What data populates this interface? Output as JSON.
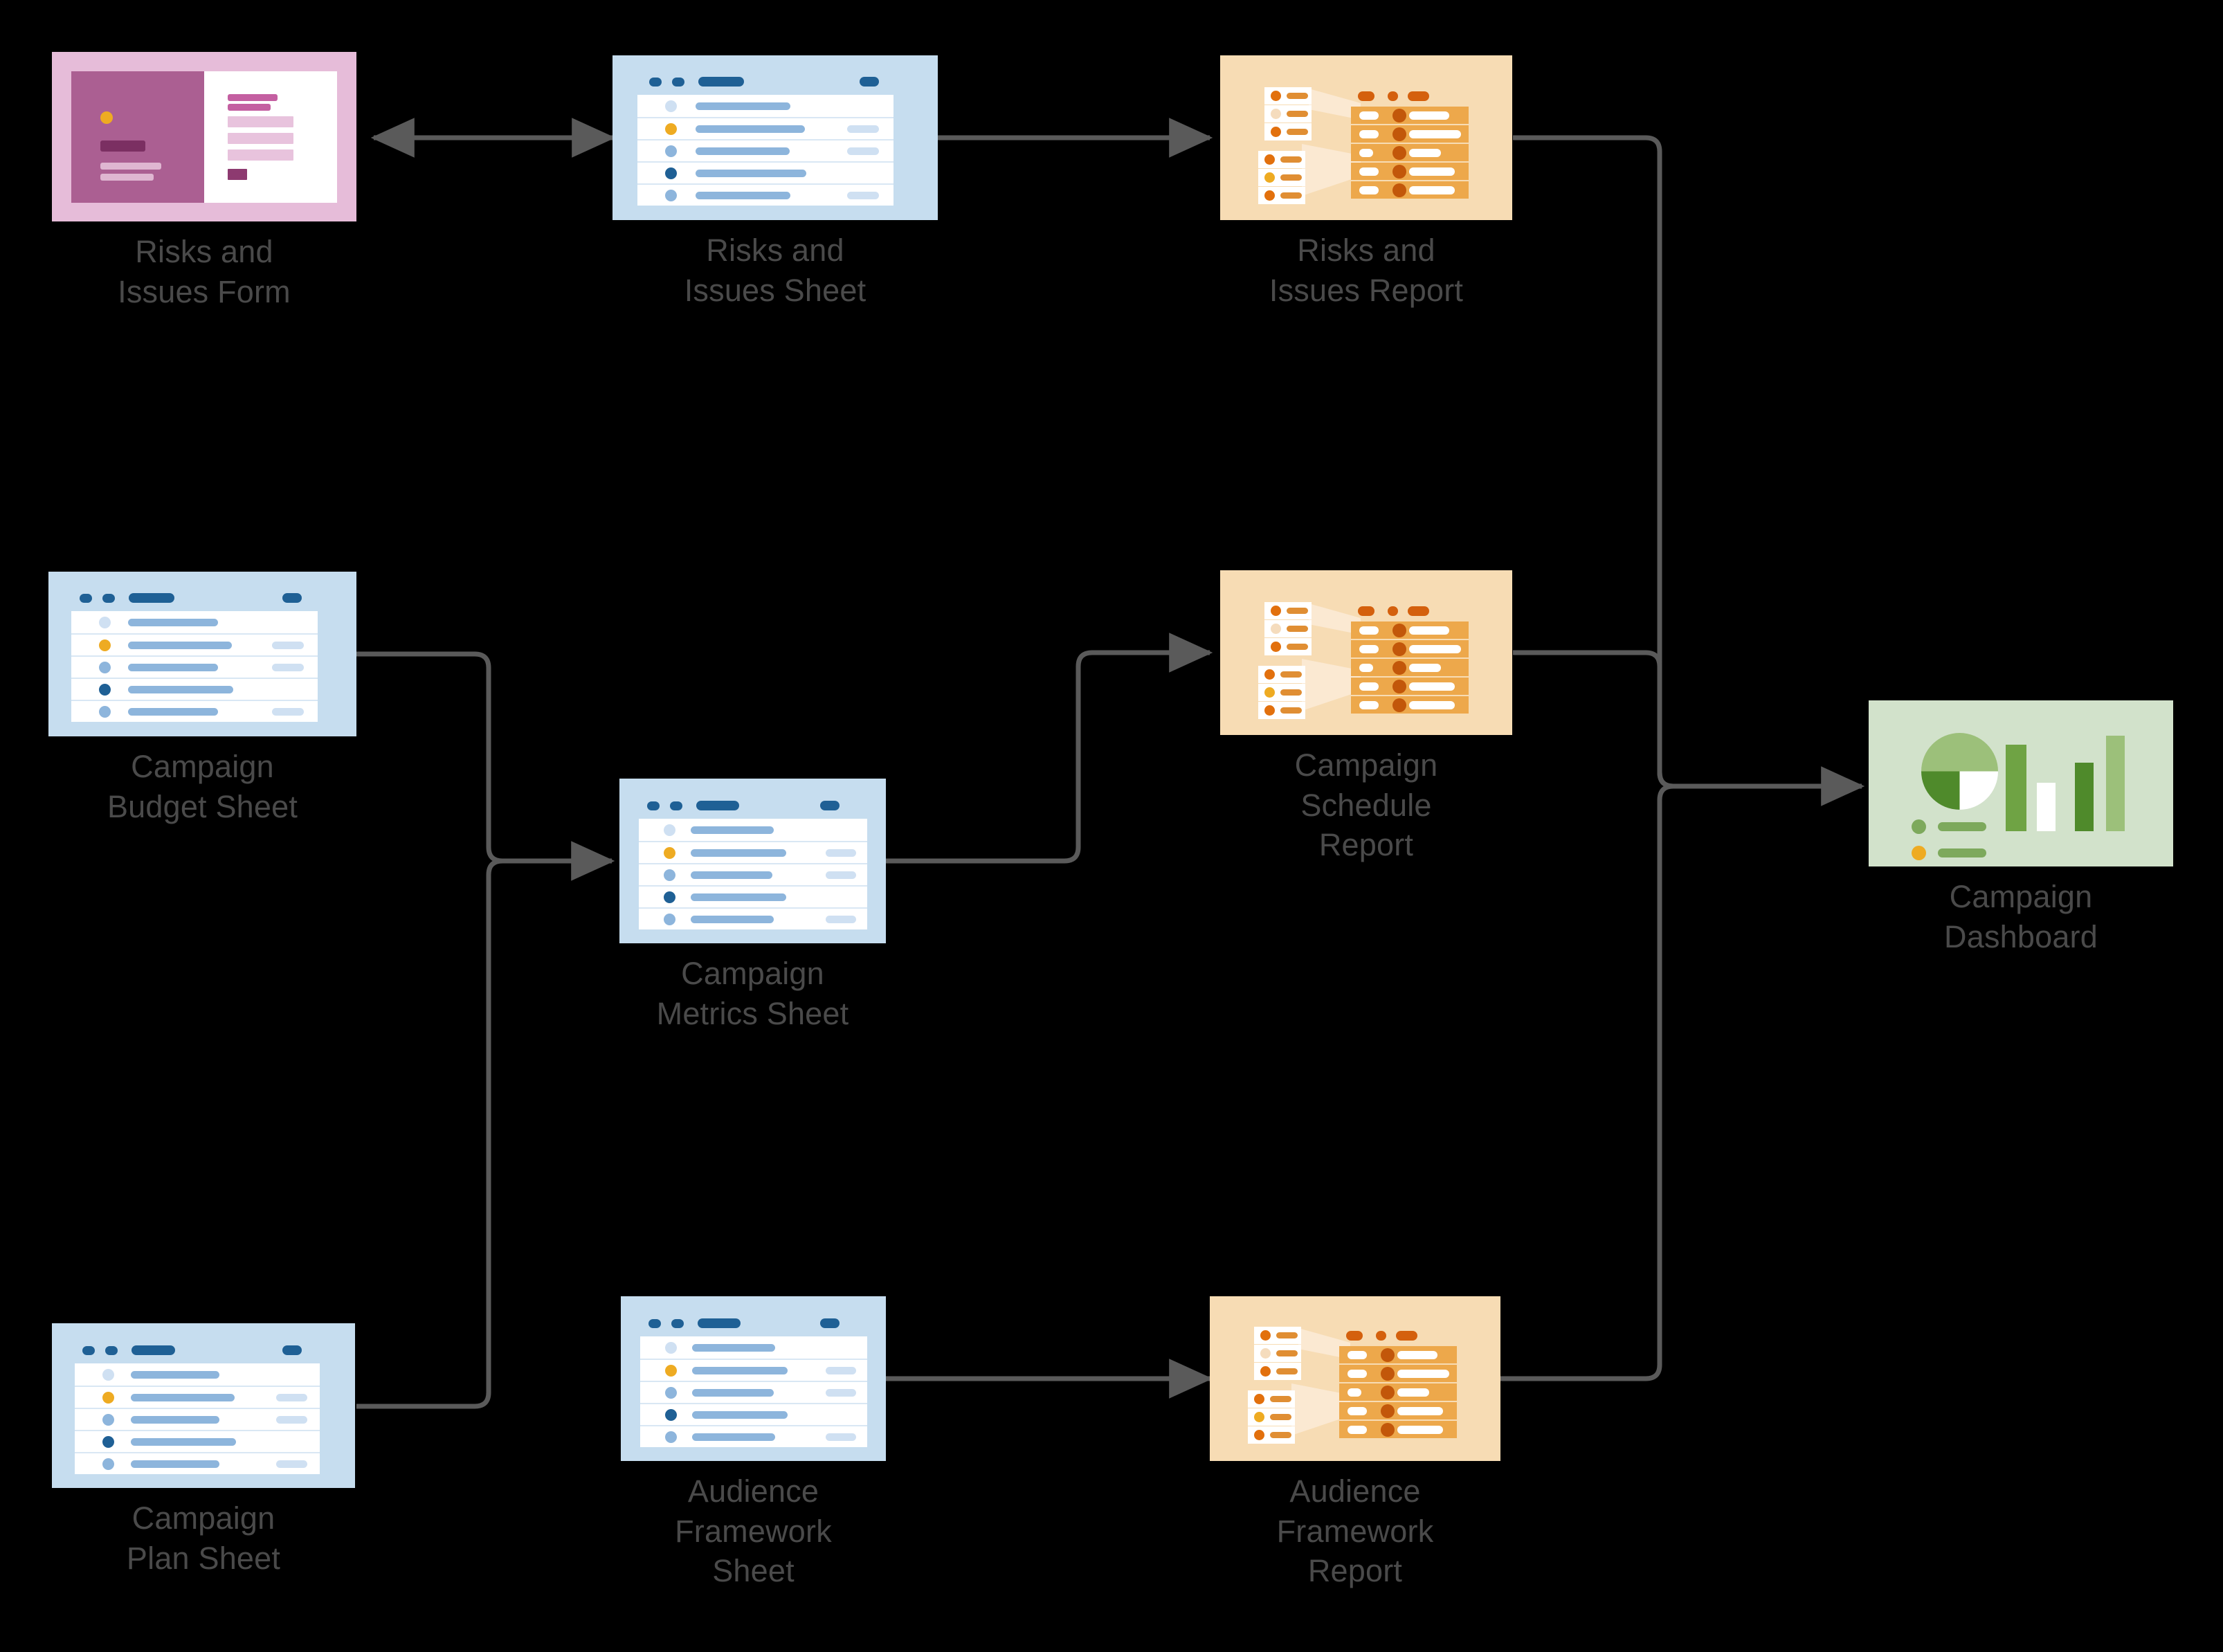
{
  "diagram": {
    "title": "Campaign data flow diagram",
    "background": "#000000",
    "edge_color": "#5a5a5a",
    "label_color": "#4a4a4a",
    "palette": {
      "sheet_bg": "#c6ddef",
      "sheet_accent": "#1f6095",
      "sheet_line": "#8db5dc",
      "sheet_line_light": "#cfe0f2",
      "report_bg": "#f7dcb4",
      "report_row": "#eda84b",
      "report_accent": "#d4600d",
      "report_dot": "#c2570a",
      "form_bg": "#e6bcd9",
      "form_panel": "#ab5f92",
      "form_dark": "#7b2f62",
      "dashboard_bg": "#d2e2cb",
      "dashboard_green_dark": "#4f8a2b",
      "dashboard_green_mid": "#6fa344",
      "dashboard_green_light": "#9cc07a",
      "amber": "#eeab22"
    }
  },
  "nodes": [
    {
      "id": "risks-issues-form",
      "label": "Risks and\nIssues Form",
      "type": "form"
    },
    {
      "id": "risks-issues-sheet",
      "label": "Risks and\nIssues Sheet",
      "type": "sheet"
    },
    {
      "id": "risks-issues-report",
      "label": "Risks and\nIssues Report",
      "type": "report"
    },
    {
      "id": "campaign-budget-sheet",
      "label": "Campaign\nBudget Sheet",
      "type": "sheet"
    },
    {
      "id": "campaign-metrics-sheet",
      "label": "Campaign\nMetrics Sheet",
      "type": "sheet"
    },
    {
      "id": "campaign-schedule-report",
      "label": "Campaign\nSchedule\nReport",
      "type": "report"
    },
    {
      "id": "campaign-dashboard",
      "label": "Campaign\nDashboard",
      "type": "dashboard"
    },
    {
      "id": "campaign-plan-sheet",
      "label": "Campaign\nPlan Sheet",
      "type": "sheet"
    },
    {
      "id": "audience-framework-sheet",
      "label": "Audience\nFramework\nSheet",
      "type": "sheet"
    },
    {
      "id": "audience-framework-report",
      "label": "Audience\nFramework\nReport",
      "type": "report"
    }
  ],
  "edges": [
    {
      "from": "risks-issues-form",
      "to": "risks-issues-sheet",
      "direction": "both"
    },
    {
      "from": "risks-issues-sheet",
      "to": "risks-issues-report",
      "direction": "forward"
    },
    {
      "from": "risks-issues-report",
      "to": "campaign-dashboard",
      "direction": "forward"
    },
    {
      "from": "campaign-budget-sheet",
      "to": "campaign-metrics-sheet",
      "direction": "forward"
    },
    {
      "from": "campaign-plan-sheet",
      "to": "campaign-metrics-sheet",
      "direction": "forward"
    },
    {
      "from": "campaign-metrics-sheet",
      "to": "campaign-schedule-report",
      "direction": "forward"
    },
    {
      "from": "campaign-schedule-report",
      "to": "campaign-dashboard",
      "direction": "forward"
    },
    {
      "from": "audience-framework-sheet",
      "to": "audience-framework-report",
      "direction": "forward"
    },
    {
      "from": "audience-framework-report",
      "to": "campaign-dashboard",
      "direction": "forward"
    }
  ]
}
